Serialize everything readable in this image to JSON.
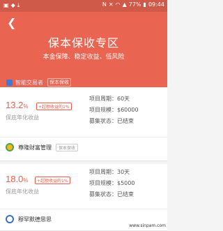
{
  "status_bar": {
    "battery": "77%",
    "time": "09:44",
    "icons": [
      "photo-icon",
      "notification-icon",
      "download-icon",
      "nfc-icon",
      "mute-icon",
      "wifi-icon",
      "signal-icon",
      "battery-icon"
    ]
  },
  "header": {
    "back_icon": "chevron-left-icon",
    "title": "保本保收专区",
    "subtitle": "本金保障、稳定收益、低风险",
    "partial_platform": {
      "name": "智能交易者",
      "tag": "保本保收"
    }
  },
  "cards": [
    {
      "rate_value": "13.2",
      "rate_unit": "%",
      "bonus": "+超额收益的1%",
      "rate_label": "保底年化收益",
      "period": "项目周期：60天",
      "scale": "项目规模：$60000",
      "status": "募集状态：已结束",
      "platform_name": "尊隆财富管理",
      "platform_tag": "保本保收"
    },
    {
      "rate_value": "18.0",
      "rate_unit": "%",
      "bonus": "+超额收益的1%",
      "rate_label": "保底年化收益",
      "period": "项目周期：30天",
      "scale": "项目规模：$5000",
      "status": "募集状态：已结束",
      "platform_name": "穆罕默德思思",
      "platform_tag": "保本保收"
    }
  ],
  "watermark": "www.sinpam.com",
  "colors": {
    "accent": "#ea6551",
    "rate": "#e8604d",
    "status_bar": "#cf5a4a"
  }
}
